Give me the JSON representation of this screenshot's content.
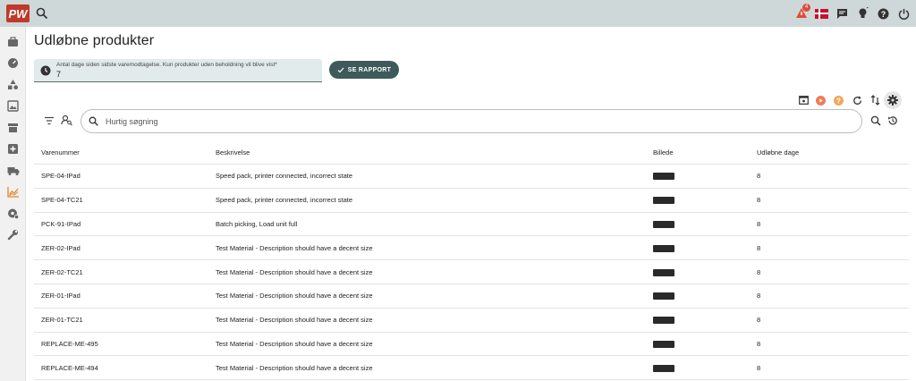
{
  "app": {
    "logo_text": "PW"
  },
  "topbar": {
    "notification_count": "4"
  },
  "page": {
    "title": "Udløbne produkter"
  },
  "filter": {
    "label": "Antal dage siden sidste varemodtagelse. Kun produkter uden beholdning vil blive vist*",
    "value": "7"
  },
  "report_button": {
    "label": "SE RAPPORT"
  },
  "search": {
    "placeholder": "Hurtig søgning"
  },
  "table": {
    "headers": [
      "Varenummer",
      "Beskrivelse",
      "Billede",
      "Udløbne dage"
    ],
    "rows": [
      {
        "sku": "SPE-04-IPad",
        "desc": "Speed pack, printer connected, incorrect state",
        "days": "8"
      },
      {
        "sku": "SPE-04-TC21",
        "desc": "Speed pack, printer connected, incorrect state",
        "days": "8"
      },
      {
        "sku": "PCK-91-IPad",
        "desc": "Batch picking, Load unit full",
        "days": "8"
      },
      {
        "sku": "ZER-02-IPad",
        "desc": "Test Material - Description should have a decent size",
        "days": "8"
      },
      {
        "sku": "ZER-02-TC21",
        "desc": "Test Material - Description should have a decent size",
        "days": "8"
      },
      {
        "sku": "ZER-01-IPad",
        "desc": "Test Material - Description should have a decent size",
        "days": "8"
      },
      {
        "sku": "ZER-01-TC21",
        "desc": "Test Material - Description should have a decent size",
        "days": "8"
      },
      {
        "sku": "REPLACE-ME-495",
        "desc": "Test Material - Description should have a decent size",
        "days": "8"
      },
      {
        "sku": "REPLACE-ME-494",
        "desc": "Test Material - Description should have a decent size",
        "days": "8"
      }
    ]
  },
  "colors": {
    "topbar": "#ced8d8",
    "accent": "#3f5a5b",
    "active_nav": "#e0892f",
    "badge": "#e04b3a"
  },
  "icons": {
    "sidebar": [
      "briefcase-icon",
      "dashboard-gauge-icon",
      "shapes-icon",
      "image-icon",
      "store-icon",
      "medical-box-icon",
      "truck-icon",
      "chart-icon",
      "settings-cog-icon",
      "wrench-icon"
    ],
    "topbar": [
      "alert-icon",
      "flag-dk-icon",
      "chat-icon",
      "lightbulb-icon",
      "help-icon",
      "power-icon"
    ]
  }
}
